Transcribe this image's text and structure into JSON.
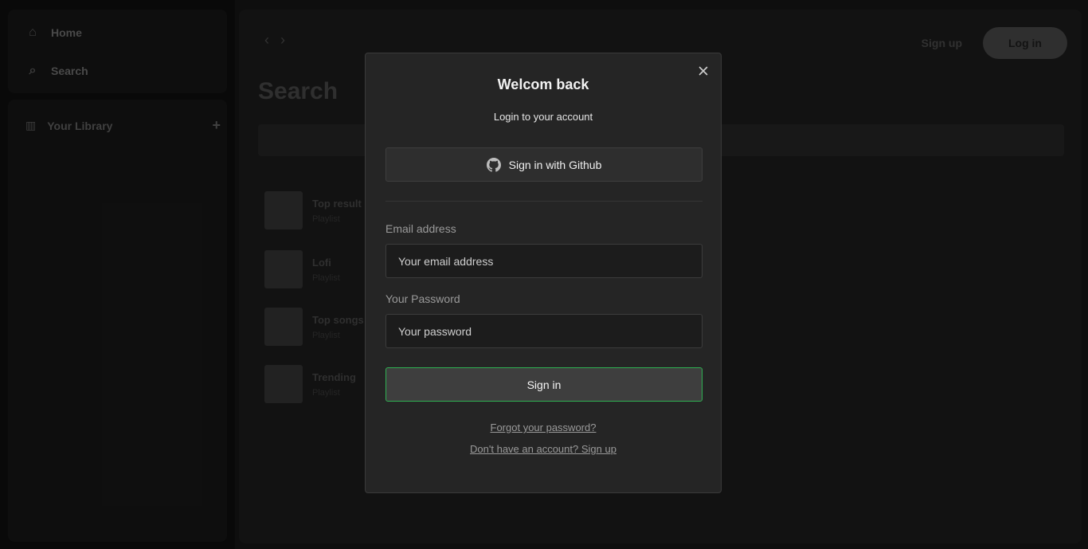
{
  "background": {
    "sidebar": {
      "home_label": "Home",
      "search_label": "Search",
      "library_label": "Your Library"
    },
    "header": {
      "signup_label": "Sign up",
      "login_label": "Log in"
    },
    "page_title": "Search",
    "results": [
      {
        "title": "Top result",
        "subtitle": "Playlist"
      },
      {
        "title": "Lofi",
        "subtitle": "Playlist"
      },
      {
        "title": "Top songs",
        "subtitle": "Playlist"
      },
      {
        "title": "Trending",
        "subtitle": "Playlist"
      }
    ]
  },
  "modal": {
    "title": "Welcom back",
    "subtitle": "Login to your account",
    "github_button": "Sign in with Github",
    "email_label": "Email address",
    "email_placeholder": "Your email address",
    "password_label": "Your Password",
    "password_placeholder": "Your password",
    "signin_button": "Sign in",
    "forgot_link": "Forgot your password?",
    "signup_link": "Don't have an account? Sign up"
  },
  "colors": {
    "accent": "#2fb152",
    "modal_bg": "#252525",
    "page_bg": "#121212"
  }
}
